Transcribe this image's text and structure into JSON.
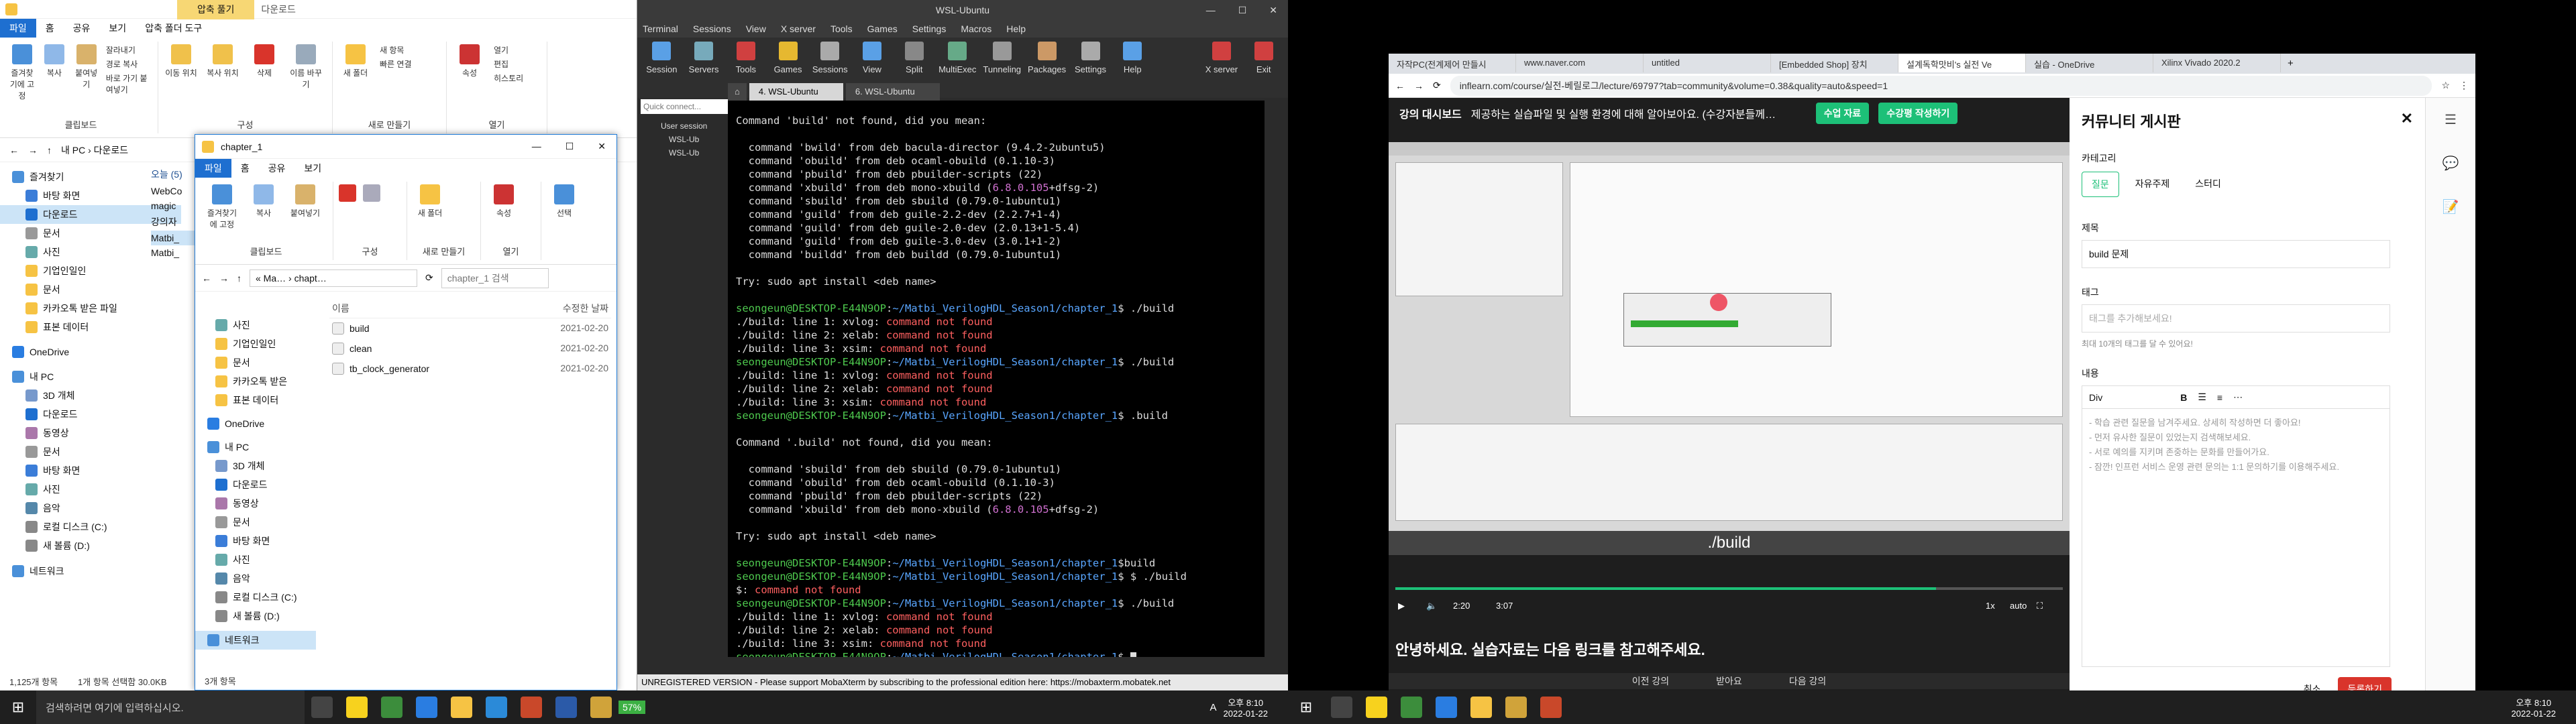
{
  "explorer": {
    "title_tabs": [
      "파일",
      "홈",
      "공유",
      "보기",
      "압축 폴더 도구"
    ],
    "context_tab": "압축 풀기",
    "context_title": "다운로드",
    "ribbon_groups": [
      {
        "label": "클립보드",
        "buttons": [
          "즐겨찾기에 고정",
          "복사",
          "붙여넣기"
        ],
        "small": [
          "잘라내기",
          "경로 복사",
          "바로 가기 붙여넣기"
        ]
      },
      {
        "label": "구성",
        "buttons": [
          "이동 위치",
          "복사 위치",
          "삭제",
          "이름 바꾸기"
        ]
      },
      {
        "label": "새로 만들기",
        "buttons": [
          "새 폴더"
        ],
        "small": [
          "새 항목",
          "빠른 연결"
        ]
      },
      {
        "label": "열기",
        "buttons": [
          "속성"
        ],
        "small": [
          "열기",
          "편집",
          "히스토리"
        ]
      }
    ],
    "address": "내 PC › 다운로드",
    "nav": [
      "즐겨찾기",
      "바탕 화면",
      "다운로드",
      "문서",
      "사진",
      "기업인일인",
      "문서",
      "카카오톡 받은 파일",
      "표본 데이터",
      "OneDrive",
      "내 PC",
      "3D 개체",
      "다운로드",
      "동영상",
      "문서",
      "바탕 화면",
      "사진",
      "음악",
      "로컬 디스크 (C:)",
      "새 볼륨 (D:)",
      "네트워크"
    ],
    "today": "오늘 (5)",
    "files": [
      "WebCo",
      "magic",
      "강의자",
      "Matbi_",
      "Matbi_"
    ],
    "status": "1,125개 항목",
    "status2": "1개 항목 선택함 30.0KB"
  },
  "explorer2": {
    "title": "chapter_1",
    "tabs": [
      "파일",
      "홈",
      "공유",
      "보기"
    ],
    "ribbon": [
      "즐겨찾기에 고정",
      "복사",
      "붙여넣기",
      "새 폴더",
      "속성",
      "선택"
    ],
    "groups": [
      "클립보드",
      "구성",
      "새로 만들기",
      "열기"
    ],
    "address": "« Ma… › chapt…",
    "search": "chapter_1 검색",
    "col_name": "이름",
    "col_date": "수정한 날짜",
    "nav": [
      "사진",
      "기업인일인",
      "문서",
      "카카오톡 받은",
      "표본 데이터",
      "OneDrive",
      "내 PC",
      "3D 개체",
      "다운로드",
      "동영상",
      "문서",
      "바탕 화면",
      "사진",
      "음악",
      "로컬 디스크 (C:)",
      "새 볼륨 (D:)",
      "네트워크"
    ],
    "files": [
      {
        "name": "build",
        "date": "2021-02-20"
      },
      {
        "name": "clean",
        "date": "2021-02-20"
      },
      {
        "name": "tb_clock_generator",
        "date": "2021-02-20"
      }
    ],
    "status": "3개 항목"
  },
  "moba": {
    "title": "WSL-Ubuntu",
    "menu": [
      "Terminal",
      "Sessions",
      "View",
      "X server",
      "Tools",
      "Games",
      "Settings",
      "Macros",
      "Help"
    ],
    "tools": [
      "Session",
      "Servers",
      "Tools",
      "Games",
      "Sessions",
      "View",
      "Split",
      "MultiExec",
      "Tunneling",
      "Packages",
      "Settings",
      "Help"
    ],
    "xserver": "X server",
    "exit": "Exit",
    "quick": "Quick connect...",
    "tabs": [
      "4. WSL-Ubuntu",
      "6. WSL-Ubuntu"
    ],
    "sessions": [
      "User session",
      "WSL-Ub",
      "WSL-Ub"
    ],
    "footer": "UNREGISTERED VERSION  -  Please support MobaXterm by subscribing to the professional edition here:  https://mobaxterm.mobatek.net",
    "lines": [
      [
        [
          "w",
          "Command 'build' not found, did you mean:"
        ]
      ],
      [
        [
          "w",
          ""
        ]
      ],
      [
        [
          "w",
          "  command 'bwild' from deb bacula-director (9.4.2-2ubuntu5)"
        ]
      ],
      [
        [
          "w",
          "  command 'obuild' from deb ocaml-obuild (0.1.10-3)"
        ]
      ],
      [
        [
          "w",
          "  command 'pbuild' from deb pbuilder-scripts (22)"
        ]
      ],
      [
        [
          "w",
          "  command 'xbuild' from deb mono-xbuild ("
        ],
        [
          "m",
          "6.8.0.105"
        ],
        [
          "w",
          "+dfsg-2)"
        ]
      ],
      [
        [
          "w",
          "  command 'sbuild' from deb sbuild (0.79.0-1ubuntu1)"
        ]
      ],
      [
        [
          "w",
          "  command 'guild' from deb guile-2.2-dev (2.2.7+1-4)"
        ]
      ],
      [
        [
          "w",
          "  command 'guild' from deb guile-2.0-dev (2.0.13+1-5.4)"
        ]
      ],
      [
        [
          "w",
          "  command 'guild' from deb guile-3.0-dev (3.0.1+1-2)"
        ]
      ],
      [
        [
          "w",
          "  command 'buildd' from deb buildd (0.79.0-1ubuntu1)"
        ]
      ],
      [
        [
          "w",
          ""
        ]
      ],
      [
        [
          "w",
          "Try: sudo apt install <deb name>"
        ]
      ],
      [
        [
          "w",
          ""
        ]
      ],
      [
        [
          "g",
          "seongeun@DESKTOP-E44N9OP"
        ],
        [
          "w",
          ":"
        ],
        [
          "b",
          "~/Matbi_VerilogHDL_Season1/chapter_1"
        ],
        [
          "w",
          "$ ./build"
        ]
      ],
      [
        [
          "w",
          "./build: line 1: xvlog: "
        ],
        [
          "r",
          "command not found"
        ]
      ],
      [
        [
          "w",
          "./build: line 2: xelab: "
        ],
        [
          "r",
          "command not found"
        ]
      ],
      [
        [
          "w",
          "./build: line 3: xsim: "
        ],
        [
          "r",
          "command not found"
        ]
      ],
      [
        [
          "g",
          "seongeun@DESKTOP-E44N9OP"
        ],
        [
          "w",
          ":"
        ],
        [
          "b",
          "~/Matbi_VerilogHDL_Season1/chapter_1"
        ],
        [
          "w",
          "$ ./build"
        ]
      ],
      [
        [
          "w",
          "./build: line 1: xvlog: "
        ],
        [
          "r",
          "command not found"
        ]
      ],
      [
        [
          "w",
          "./build: line 2: xelab: "
        ],
        [
          "r",
          "command not found"
        ]
      ],
      [
        [
          "w",
          "./build: line 3: xsim: "
        ],
        [
          "r",
          "command not found"
        ]
      ],
      [
        [
          "g",
          "seongeun@DESKTOP-E44N9OP"
        ],
        [
          "w",
          ":"
        ],
        [
          "b",
          "~/Matbi_VerilogHDL_Season1/chapter_1"
        ],
        [
          "w",
          "$ .build"
        ]
      ],
      [
        [
          "w",
          ""
        ]
      ],
      [
        [
          "w",
          "Command '.build' not found, did you mean:"
        ]
      ],
      [
        [
          "w",
          ""
        ]
      ],
      [
        [
          "w",
          "  command 'sbuild' from deb sbuild (0.79.0-1ubuntu1)"
        ]
      ],
      [
        [
          "w",
          "  command 'obuild' from deb ocaml-obuild (0.1.10-3)"
        ]
      ],
      [
        [
          "w",
          "  command 'pbuild' from deb pbuilder-scripts (22)"
        ]
      ],
      [
        [
          "w",
          "  command 'xbuild' from deb mono-xbuild ("
        ],
        [
          "m",
          "6.8.0.105"
        ],
        [
          "w",
          "+dfsg-2)"
        ]
      ],
      [
        [
          "w",
          ""
        ]
      ],
      [
        [
          "w",
          "Try: sudo apt install <deb name>"
        ]
      ],
      [
        [
          "w",
          ""
        ]
      ],
      [
        [
          "g",
          "seongeun@DESKTOP-E44N9OP"
        ],
        [
          "w",
          ":"
        ],
        [
          "b",
          "~/Matbi_VerilogHDL_Season1/chapter_1"
        ],
        [
          "w",
          "$build"
        ]
      ],
      [
        [
          "g",
          "seongeun@DESKTOP-E44N9OP"
        ],
        [
          "w",
          ":"
        ],
        [
          "b",
          "~/Matbi_VerilogHDL_Season1/chapter_1"
        ],
        [
          "w",
          "$ $ ./build"
        ]
      ],
      [
        [
          "w",
          "$: "
        ],
        [
          "r",
          "command not found"
        ]
      ],
      [
        [
          "g",
          "seongeun@DESKTOP-E44N9OP"
        ],
        [
          "w",
          ":"
        ],
        [
          "b",
          "~/Matbi_VerilogHDL_Season1/chapter_1"
        ],
        [
          "w",
          "$ ./build"
        ]
      ],
      [
        [
          "w",
          "./build: line 1: xvlog: "
        ],
        [
          "r",
          "command not found"
        ]
      ],
      [
        [
          "w",
          "./build: line 2: xelab: "
        ],
        [
          "r",
          "command not found"
        ]
      ],
      [
        [
          "w",
          "./build: line 3: xsim: "
        ],
        [
          "r",
          "command not found"
        ]
      ],
      [
        [
          "g",
          "seongeun@DESKTOP-E44N9OP"
        ],
        [
          "w",
          ":"
        ],
        [
          "b",
          "~/Matbi_VerilogHDL_Season1/chapter_1"
        ],
        [
          "w",
          "$ "
        ]
      ]
    ]
  },
  "browser": {
    "tabs": [
      "자작PC(전계제어 만들시",
      "www.naver.com",
      "untitled",
      "[Embedded Shop] 장치",
      "설계독학맛비's 실전 Ve",
      "실습 - OneDrive",
      "Xilinx Vivado 2020.2"
    ],
    "url": "inflearn.com/course/실전-베릴로그/lecture/69797?tab=community&volume=0.38&quality=auto&speed=1",
    "course_dashboard": "강의 대시보드",
    "lecture_title": "제공하는 실습파일 및 실행 환경에 대해 알아보아요. (수강자분들께…",
    "btn_material": "수업 자료",
    "btn_note": "수강평 작성하기",
    "video_caption": "./build",
    "time_current": "2:20",
    "time_total": "3:07",
    "rate": "1x",
    "quality": "auto",
    "progress_ratio": 0.81,
    "notice": "안녕하세요. 실습자료는 다음 링크를 참고해주세요.",
    "prev": "이전 강의",
    "next": "다음 강의",
    "mid": "받아요",
    "panel": {
      "title": "커뮤니티 게시판",
      "category_label": "카테고리",
      "categories": [
        "질문",
        "자유주제",
        "스터디"
      ],
      "title_label": "제목",
      "title_value": "build 문제",
      "tag_label": "태그",
      "tag_placeholder": "태그를 추가해보세요!",
      "tag_hint": "최대 10개의 태그를 달 수 있어요!",
      "content_label": "내용",
      "font": "Div",
      "placeholder_lines": [
        "- 학습 관련 질문을 남겨주세요. 상세히 작성하면 더 좋아요!",
        "- 먼저 유사한 질문이 있었는지 검색해보세요.",
        "- 서로 예의를 지키며 존중하는 문화를 만들어가요.",
        "- 잠깐! 인프런 서비스 운영 관련 문의는 1:1 문의하기를 이용해주세요."
      ],
      "cancel": "취소",
      "submit": "등록하기"
    }
  },
  "taskbar": {
    "search": "검색하려면 여기에 입력하십시오.",
    "cpu": "57%",
    "time": "오후 8:10",
    "date": "2022-01-22",
    "ime": "A",
    "time2": "오후 8:10",
    "date2": "2022-01-22"
  }
}
